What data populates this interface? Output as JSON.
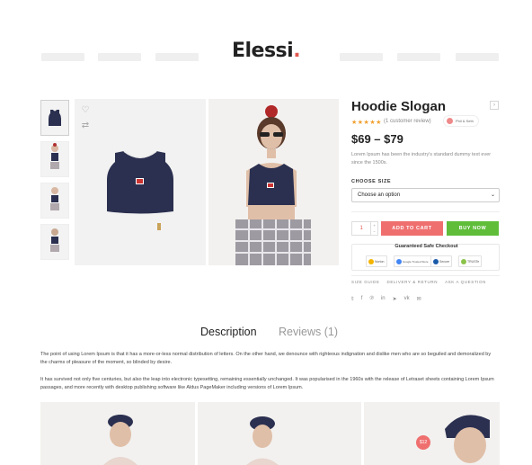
{
  "brand": {
    "name": "Elessi",
    "dot": ".",
    "accent": "#e2584f"
  },
  "product": {
    "title": "Hoodie Slogan",
    "rating_stars": "★★★★★",
    "rating": 5,
    "review_text": "(1 customer review)",
    "viewing_text": "Phil & Seth",
    "price": "$69 – $79",
    "description": "Lorem Ipsum has been the industry's standard dummy text ever since the 1500s.",
    "size_label": "CHOOSE SIZE",
    "size_select": "Choose an option",
    "quantity": "1",
    "add_to_cart": "ADD TO CART",
    "buy_now": "BUY NOW",
    "checkout_title": "Guaranteed Safe Checkout",
    "badges": [
      {
        "name": "Norton",
        "color": "#f4b400"
      },
      {
        "name": "Google Trusted Store",
        "color": "#4285f4"
      },
      {
        "name": "Secure",
        "color": "#1a5aa8"
      },
      {
        "name": "TRUSTe",
        "color": "#8bc34a"
      }
    ],
    "links": [
      "SIZE GUIDE",
      "DELIVERY & RETURN",
      "ASK A QUESTION"
    ],
    "share_icons": [
      "twitter-icon",
      "facebook-icon",
      "pinterest-icon",
      "linkedin-icon",
      "telegram-icon",
      "vk-icon",
      "email-icon"
    ],
    "share_glyphs": [
      "𝕥",
      "f",
      "℗",
      "in",
      "➤",
      "vk",
      "✉"
    ]
  },
  "tabs": [
    {
      "label": "Description"
    },
    {
      "label": "Reviews (1)"
    }
  ],
  "description": {
    "p1": "The point of using Lorem Ipsum is that it has a more-or-less normal distribution of letters. On the other hand, we denounce with righteous indignation and dislike men who are so beguiled and demoralized by the charms of pleasure of the moment, so blinded by desire.",
    "p2": "It has survived not only five centuries, but also the leap into electronic typesetting, remaining essentially unchanged. It was popularised in the 1960s with the release of Letraset sheets containing Lorem Ipsum passages, and more recently with desktop publishing software like Aldus PageMaker including versions of Lorem Ipsum."
  },
  "banner": {
    "price_badge": "$12"
  }
}
